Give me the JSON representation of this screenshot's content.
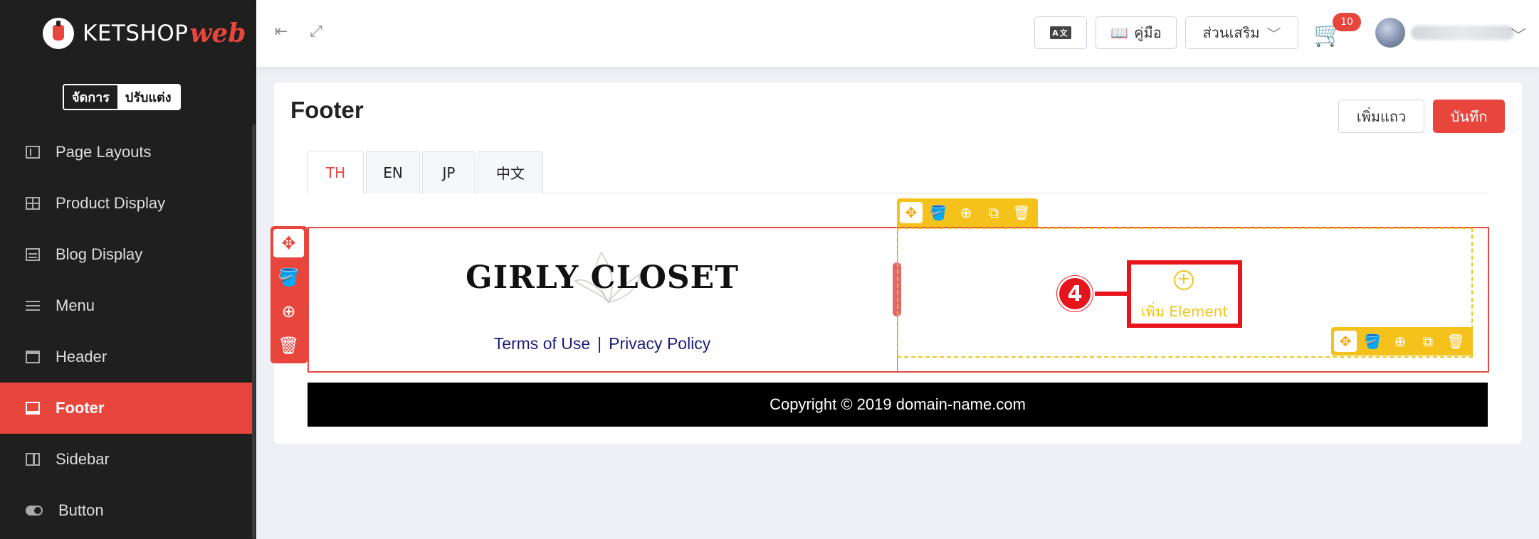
{
  "brand": {
    "name": "KETSHOP",
    "suffix": "web"
  },
  "mode_toggle": {
    "manage": "จัดการ",
    "customize": "ปรับแต่ง"
  },
  "sidebar": {
    "items": [
      {
        "label": "Page Layouts",
        "icon": "page-layout-icon"
      },
      {
        "label": "Product Display",
        "icon": "grid-icon"
      },
      {
        "label": "Blog Display",
        "icon": "blog-icon"
      },
      {
        "label": "Menu",
        "icon": "menu-icon"
      },
      {
        "label": "Header",
        "icon": "header-icon"
      },
      {
        "label": "Footer",
        "icon": "footer-icon",
        "active": true
      },
      {
        "label": "Sidebar",
        "icon": "sidebar-icon"
      },
      {
        "label": "Button",
        "icon": "toggle-icon"
      }
    ]
  },
  "topbar": {
    "translate_icon_text": "A文",
    "manual_label": "คู่มือ",
    "addons_label": "ส่วนเสริม",
    "cart_count": "10"
  },
  "page": {
    "title": "Footer",
    "add_row_label": "เพิ่มแถว",
    "save_label": "บันทึก",
    "tabs": [
      "TH",
      "EN",
      "JP",
      "中文"
    ]
  },
  "footer_preview": {
    "brand_text": "GIRLY CLOSET",
    "link_terms": "Terms of Use",
    "link_separator": "|",
    "link_privacy": "Privacy Policy",
    "add_element_label": "เพิ่ม Element",
    "step_number": "4",
    "copyright": "Copyright © 2019 domain-name.com"
  },
  "colors": {
    "accent": "#e8453c",
    "sidebar_bg": "#1f1f1f",
    "yellow": "#f5c21b"
  }
}
